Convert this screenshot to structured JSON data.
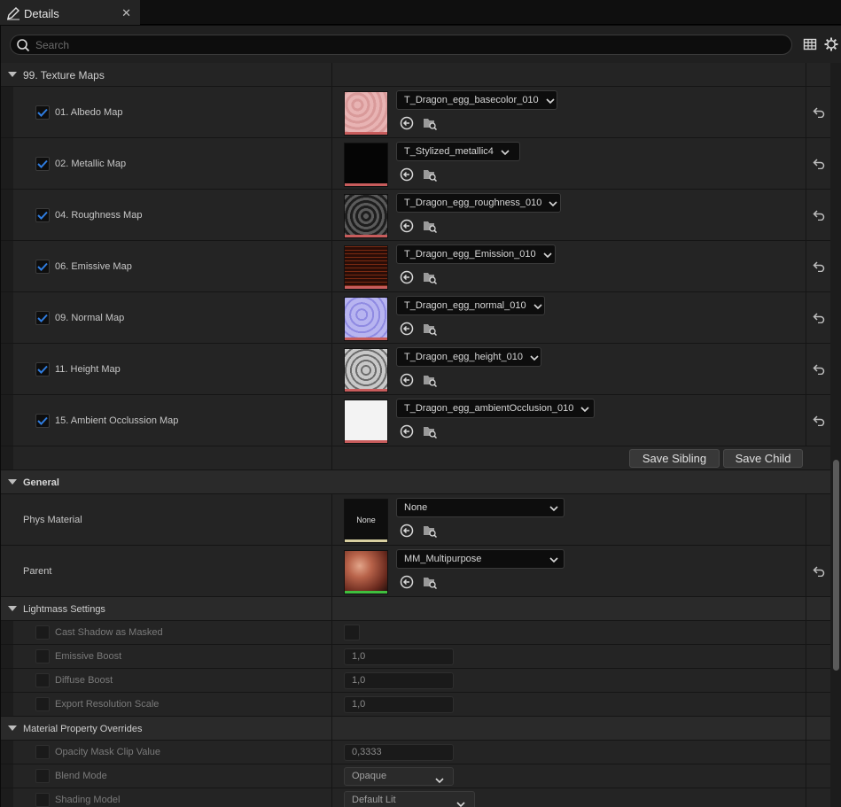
{
  "tab": {
    "title": "Details",
    "close_glyph": "✕",
    "icon": "pencil-icon"
  },
  "search": {
    "placeholder": "Search",
    "value": ""
  },
  "toolbar": {
    "icons": [
      "table-view-icon",
      "gear-icon"
    ]
  },
  "texture_maps": {
    "category_label": "99. Texture Maps",
    "items": [
      {
        "label": "01. Albedo Map",
        "checked": true,
        "asset": "T_Dragon_egg_basecolor_010"
      },
      {
        "label": "02. Metallic Map",
        "checked": true,
        "asset": "T_Stylized_metallic4"
      },
      {
        "label": "04. Roughness Map",
        "checked": true,
        "asset": "T_Dragon_egg_roughness_010"
      },
      {
        "label": "06. Emissive Map",
        "checked": true,
        "asset": "T_Dragon_egg_Emission_010"
      },
      {
        "label": "09. Normal Map",
        "checked": true,
        "asset": "T_Dragon_egg_normal_010"
      },
      {
        "label": "11. Height Map",
        "checked": true,
        "asset": "T_Dragon_egg_height_010"
      },
      {
        "label": "15. Ambient Occlussion Map",
        "checked": true,
        "asset": "T_Dragon_egg_ambientOcclusion_010"
      }
    ],
    "save_sibling_label": "Save Sibling",
    "save_child_label": "Save Child"
  },
  "general": {
    "category_label": "General",
    "phys_material": {
      "label": "Phys Material",
      "thumb_text": "None",
      "value": "None"
    },
    "parent": {
      "label": "Parent",
      "value": "MM_Multipurpose"
    }
  },
  "lightmass": {
    "category_label": "Lightmass Settings",
    "items": [
      {
        "label": "Cast Shadow as Masked",
        "value": ""
      },
      {
        "label": "Emissive Boost",
        "value": "1,0"
      },
      {
        "label": "Diffuse Boost",
        "value": "1,0"
      },
      {
        "label": "Export Resolution Scale",
        "value": "1,0"
      }
    ]
  },
  "overrides": {
    "category_label": "Material Property Overrides",
    "items": [
      {
        "label": "Opacity Mask Clip Value",
        "value": "0,3333"
      },
      {
        "label": "Blend Mode",
        "value": "Opaque"
      },
      {
        "label": "Shading Model",
        "value": "Default Lit"
      }
    ]
  },
  "colors": {
    "accent": "#2f7de1",
    "panel": "#242424",
    "input": "#0d0d0d"
  }
}
